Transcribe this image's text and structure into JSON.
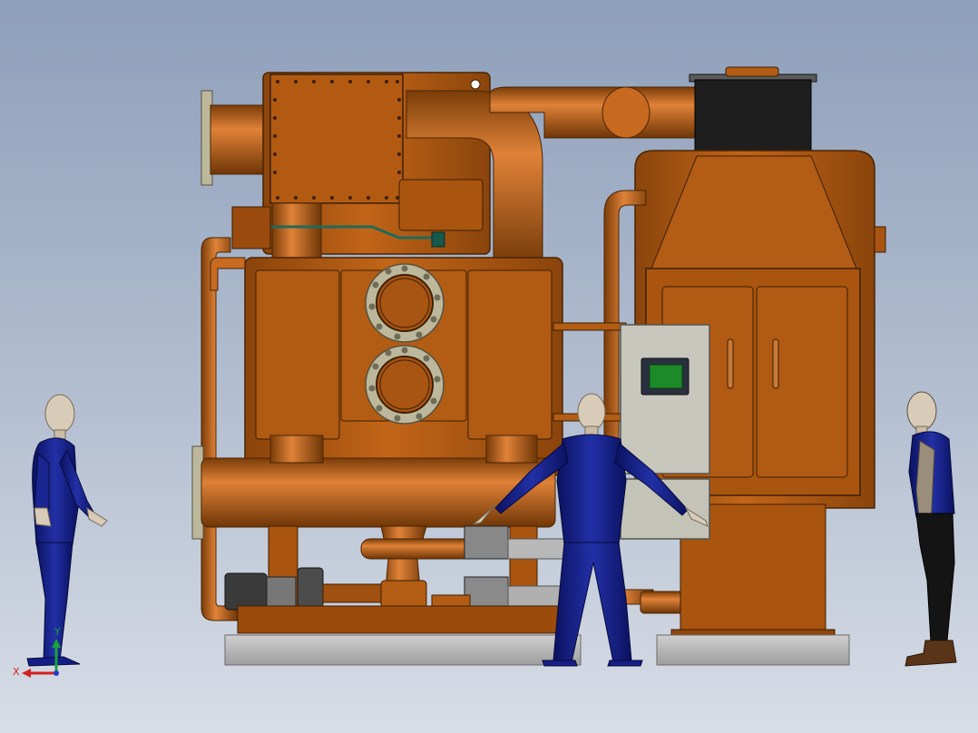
{
  "viewport": {
    "background_top": "#8e9fba",
    "background_bottom": "#d8dde6"
  },
  "colors": {
    "machine_body": "#b15a12",
    "machine_dark": "#6e3606",
    "machine_light": "#d8782e",
    "flange_gray": "#b9b59b",
    "flange_dark": "#6f6c58",
    "base_gray": "#bdbdbd",
    "cap_black": "#1e1e1e",
    "panel_gray": "#c8c7bd",
    "screen_green": "#1c8a28",
    "suit_blue": "#141e86",
    "skin": "#d8cbb7",
    "axis_x": "#d42020",
    "axis_y": "#18a23a",
    "axis_z": "#2538c8"
  },
  "model": {
    "objects": [
      "chiller-unit",
      "exhaust-stack",
      "control-panel",
      "figure-left",
      "figure-center",
      "figure-right"
    ]
  },
  "triad": {
    "x_label": "X",
    "y_label": "Y"
  }
}
